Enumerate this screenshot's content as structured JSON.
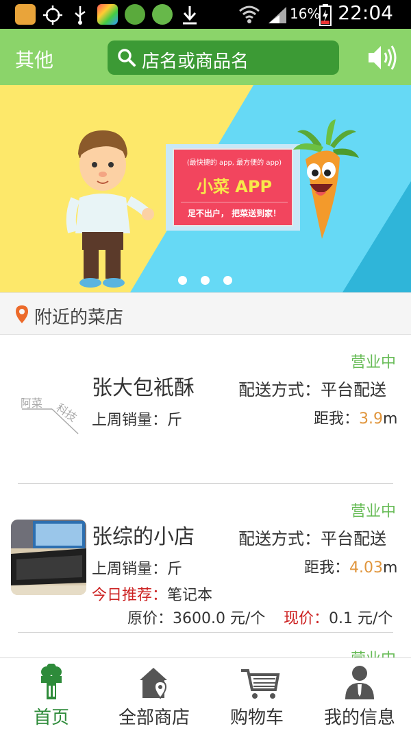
{
  "status_bar": {
    "battery_pct": "16%",
    "time": "22:04"
  },
  "header": {
    "title": "其他",
    "search_placeholder": "店名或商品名"
  },
  "banner": {
    "subtitle": "(最快捷的 app, 最方便的 app)",
    "title": "小菜 APP",
    "slogan": "足不出户， 把菜送到家！",
    "dots": 3
  },
  "section": {
    "title": "附近的菜店"
  },
  "stores": [
    {
      "status": "营业中",
      "name": "张大包衹酥",
      "delivery": "配送方式：平台配送",
      "sales": "上周销量：斤",
      "distance_label": "距我：",
      "distance_value": "3.9",
      "distance_unit": "m",
      "placeholder_text_1": "阿菜",
      "placeholder_text_2": "科技"
    },
    {
      "status": "营业中",
      "name": "张综的小店",
      "delivery": "配送方式：平台配送",
      "sales": "上周销量：斤",
      "distance_label": "距我：",
      "distance_value": "4.03",
      "distance_unit": "m",
      "recommend_label": "今日推荐：",
      "recommend_item": "笔记本",
      "original_price": "原价：3600.0 元/个",
      "current_label": "现价：",
      "current_price": "0.1 元/个"
    },
    {
      "status": "营业中"
    }
  ],
  "bottom_nav": [
    {
      "label": "首页",
      "active": true
    },
    {
      "label": "全部商店",
      "active": false
    },
    {
      "label": "购物车",
      "active": false
    },
    {
      "label": "我的信息",
      "active": false
    }
  ],
  "colors": {
    "header_green": "#8bd46a",
    "search_green": "#3c9a35",
    "active_nav": "#2e8b3a",
    "status_green": "#66bb55",
    "distance_orange": "#e0953c",
    "recommend_red": "#cc2222"
  }
}
